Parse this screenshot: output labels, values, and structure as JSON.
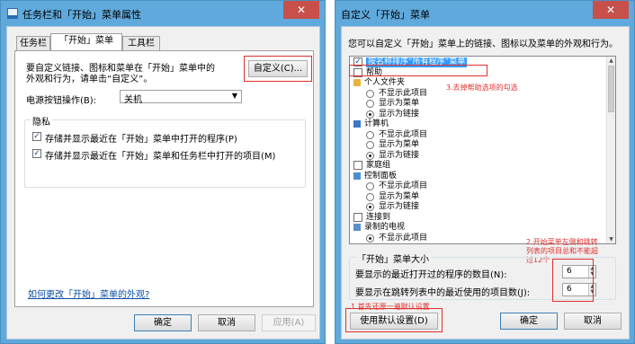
{
  "left_window": {
    "title": "任务栏和「开始」菜单属性",
    "close_glyph": "✕",
    "tabs": [
      {
        "label": "任务栏"
      },
      {
        "label": "「开始」菜单"
      },
      {
        "label": "工具栏"
      }
    ],
    "description": [
      "要自定义链接、图标和菜单在「开始」菜单中的",
      "外观和行为，请单击“自定义”。"
    ],
    "customize_button": "自定义(C)...",
    "power_label": "电源按钮操作(B):",
    "power_value": "关机",
    "privacy_label": "隐私",
    "privacy_items": [
      {
        "label": "存储并显示最近在「开始」菜单中打开的程序(P)",
        "checked": true
      },
      {
        "label": "存储并显示最近在「开始」菜单和任务栏中打开的项目(M)",
        "checked": true
      }
    ],
    "appearance_link": "如何更改「开始」菜单的外观?",
    "buttons": {
      "ok": "确定",
      "cancel": "取消",
      "apply": "应用(A)"
    }
  },
  "right_window": {
    "title": "自定义「开始」菜单",
    "close_glyph": "✕",
    "intro": "您可以自定义「开始」菜单上的链接、图标以及菜单的外观和行为。",
    "tree_items": [
      {
        "label": "按名称排序“所有程序”菜单",
        "kind": "checkbox",
        "checked": true,
        "selected": true
      },
      {
        "label": "帮助",
        "kind": "checkbox",
        "checked": false
      },
      {
        "label": "个人文件夹",
        "kind": "folder"
      },
      {
        "label": "不显示此项目",
        "kind": "radio",
        "on": false
      },
      {
        "label": "显示为菜单",
        "kind": "radio",
        "on": false
      },
      {
        "label": "显示为链接",
        "kind": "radio",
        "on": true
      },
      {
        "label": "计算机",
        "kind": "computer"
      },
      {
        "label": "不显示此项目",
        "kind": "radio",
        "on": false
      },
      {
        "label": "显示为菜单",
        "kind": "radio",
        "on": false
      },
      {
        "label": "显示为链接",
        "kind": "radio",
        "on": true
      },
      {
        "label": "家庭组",
        "kind": "checkbox",
        "checked": false
      },
      {
        "label": "控制面板",
        "kind": "panel"
      },
      {
        "label": "不显示此项目",
        "kind": "radio",
        "on": false
      },
      {
        "label": "显示为菜单",
        "kind": "radio",
        "on": false
      },
      {
        "label": "显示为链接",
        "kind": "radio",
        "on": true
      },
      {
        "label": "连接到",
        "kind": "checkbox",
        "checked": false
      },
      {
        "label": "录制的电视",
        "kind": "tv"
      },
      {
        "label": "不显示此项目",
        "kind": "radio",
        "on": true
      }
    ],
    "size_group_label": "「开始」菜单大小",
    "recent_programs_label": "要显示的最近打开过的程序的数目(N):",
    "recent_programs_value": "6",
    "jumplist_label": "要显示在跳转列表中的最近使用的项目数(J):",
    "jumplist_value": "6",
    "default_button": "使用默认设置(D)",
    "buttons": {
      "ok": "确定",
      "cancel": "取消"
    }
  },
  "annotations": {
    "step1": "1.首先还原一遍默认设置",
    "step2": [
      "2.开始菜单左侧和跳转",
      "列表的项目总和不能超",
      "过12个"
    ],
    "step3": "3.去掉帮助选项的勾选"
  },
  "colors": {
    "title_bar": "#5fa9dc",
    "close_button": "#c7504b",
    "annotation_red": "#e0302d",
    "selection": "#3399ff",
    "link": "#0a4ea3"
  }
}
